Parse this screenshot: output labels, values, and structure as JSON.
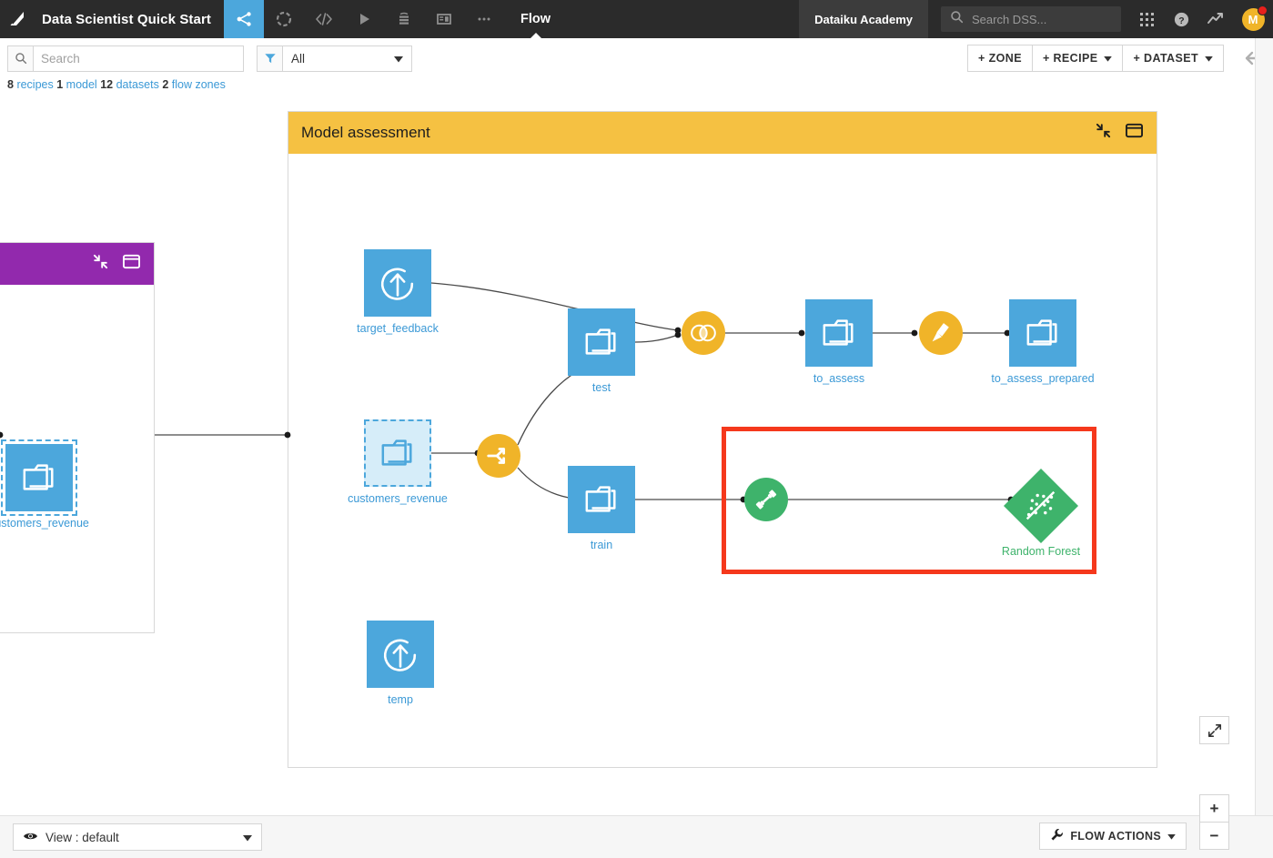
{
  "topnav": {
    "logo_icon": "dataiku-logo-icon",
    "project_title": "Data Scientist Quick Start",
    "nav_icons": [
      {
        "name": "flow-icon",
        "active": true
      },
      {
        "name": "lab-icon",
        "active": false
      },
      {
        "name": "code-icon",
        "active": false
      },
      {
        "name": "automation-play-icon",
        "active": false
      },
      {
        "name": "jobs-icon",
        "active": false
      },
      {
        "name": "dashboard-icon",
        "active": false
      },
      {
        "name": "more-ellipsis-icon",
        "active": false
      }
    ],
    "current_tab": "Flow",
    "academy_label": "Dataiku Academy",
    "search_placeholder": "Search DSS...",
    "search_value": "",
    "right_icons": [
      "apps-grid-icon",
      "help-icon",
      "trend-icon"
    ],
    "avatar_initial": "M",
    "avatar_has_notification": true
  },
  "toolbar": {
    "search_placeholder": "Search",
    "search_value": "",
    "filter_value": "All",
    "zone_label": "+ ZONE",
    "recipe_label": "+ RECIPE",
    "dataset_label": "+ DATASET",
    "back_icon": "arrow-left-icon"
  },
  "counts": {
    "recipes_n": "8",
    "recipes_label": "recipes",
    "models_n": "1",
    "models_label": "model",
    "datasets_n": "12",
    "datasets_label": "datasets",
    "zones_n": "2",
    "zones_label": "flow zones"
  },
  "zones": [
    {
      "id": "left-zone",
      "title": "",
      "color": "#9229ad",
      "collapse_icon": "collapse-arrows-icon",
      "window_icon": "window-icon"
    },
    {
      "id": "model-assessment",
      "title": "Model assessment",
      "color": "#f5c142",
      "collapse_icon": "collapse-arrows-icon",
      "window_icon": "window-icon"
    }
  ],
  "flow": {
    "left_zone_nodes": [
      {
        "name": "customers_revenue_shared",
        "label": "customers_revenue",
        "type": "dataset",
        "selected": true
      }
    ],
    "nodes": [
      {
        "name": "target_feedback",
        "label": "target_feedback",
        "type": "dataset-upload",
        "color": "#4ca7dc"
      },
      {
        "name": "test",
        "label": "test",
        "type": "dataset",
        "color": "#4ca7dc"
      },
      {
        "name": "customers_revenue",
        "label": "customers_revenue",
        "type": "dataset-shared",
        "color": "#4ca7dc"
      },
      {
        "name": "train",
        "label": "train",
        "type": "dataset",
        "color": "#4ca7dc"
      },
      {
        "name": "to_assess",
        "label": "to_assess",
        "type": "dataset",
        "color": "#4ca7dc"
      },
      {
        "name": "to_assess_prepared",
        "label": "to_assess_prepared",
        "type": "dataset",
        "color": "#4ca7dc"
      },
      {
        "name": "temp",
        "label": "temp",
        "type": "dataset-upload",
        "color": "#4ca7dc"
      },
      {
        "name": "join-recipe",
        "label": "",
        "type": "recipe-join",
        "color": "#f0b429"
      },
      {
        "name": "split-recipe",
        "label": "",
        "type": "recipe-split",
        "color": "#f0b429"
      },
      {
        "name": "prepare-recipe",
        "label": "",
        "type": "recipe-prepare",
        "color": "#f0b429"
      },
      {
        "name": "train-recipe",
        "label": "",
        "type": "recipe-train",
        "color": "#3eb36b"
      },
      {
        "name": "random-forest-model",
        "label": "Random Forest",
        "type": "model",
        "color": "#3eb36b"
      }
    ],
    "highlight": {
      "name": "training-highlight-box",
      "color": "#f5381c"
    }
  },
  "bottom": {
    "view_label": "View : default",
    "view_icon": "eye-icon",
    "flow_actions_label": "FLOW ACTIONS",
    "flow_actions_icon": "wrench-icon",
    "fit_icon": "fit-screen-icon",
    "zoom_in_label": "+",
    "zoom_out_label": "−"
  }
}
